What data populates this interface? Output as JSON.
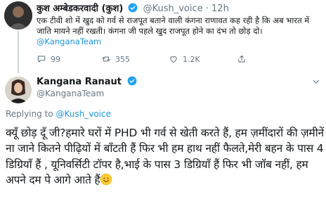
{
  "tweet1": {
    "name": "कुश अम्बेडकरवादी (कुश)",
    "handle": "@Kush_voice",
    "time": "· 12h",
    "text": "एक टीवी शो में खुद को गर्व से राजपूत बताने वाली कंगना राणावत कह रही है कि अब भारत में जाति मायने नहीं रखती। कंगना जी पहले खुद राजपूत होने का दंभ तो छोड़ दो।",
    "mention": "@KanganaTeam",
    "replies": "99",
    "retweets": "355",
    "likes": "1.2K"
  },
  "tweet2": {
    "name": "Kangana Ranaut",
    "handle": "@KanganaTeam",
    "replying_label": "Replying to",
    "replying_handle": "@Kush_voice",
    "text": "क्यूँ छोड़ दूँ जी?हमारे घरों में PHD भी गर्व से खेती करते हैं, हम ज़मींदारों की ज़मीनें ना जाने कितने पीढ़ियों में बाँटती हैं फिर भी हम हाथ नहीं फैलते,मेरी बहन के पास 4 डिग्रियाँ हैं , यूनिवर्सिटी टॉपर है,भाई के पास 3 डिग्रियाँ हैं फिर भी जॉब नहीं, हम अपने दम पे आगे आते हैं"
  },
  "icons": {
    "reply": "reply-icon",
    "retweet": "retweet-icon",
    "like": "heart-icon",
    "share": "share-icon",
    "verified": "verified-badge-icon",
    "chevron": "chevron-down-icon",
    "emoji": "smiling-face-emoji"
  },
  "colors": {
    "link": "#1b95e0",
    "verified": "#1da1f2",
    "muted": "#657786"
  }
}
